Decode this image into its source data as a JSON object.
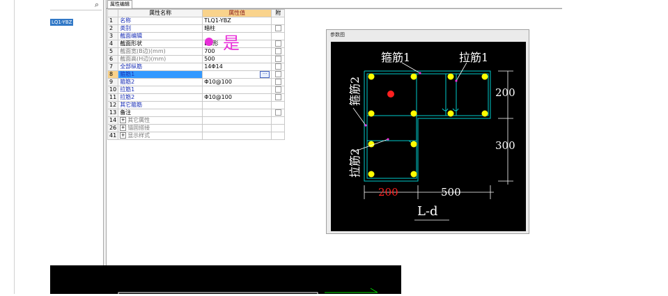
{
  "left": {
    "search_icon": "⌕",
    "tree_item": "LQ1-YBZ"
  },
  "tab": {
    "label": "属性编辑"
  },
  "grid": {
    "headers": {
      "name": "属性名称",
      "value": "属性值",
      "extra": "附"
    },
    "rows": [
      {
        "no": "1",
        "name": "名称",
        "value": "TLQ1-YBZ",
        "style": "blue",
        "cb": false
      },
      {
        "no": "2",
        "name": "类别",
        "value": "暗柱",
        "style": "blue",
        "cb": true
      },
      {
        "no": "3",
        "name": "截面编辑",
        "value": "",
        "style": "blue",
        "cb": false
      },
      {
        "no": "4",
        "name": "截面形状",
        "value": "L-d形",
        "style": "black",
        "cb": true
      },
      {
        "no": "5",
        "name": "截面宽(B边)(mm)",
        "value": "700",
        "style": "grey",
        "cb": true
      },
      {
        "no": "6",
        "name": "截面高(H边)(mm)",
        "value": "500",
        "style": "grey",
        "cb": true
      },
      {
        "no": "7",
        "name": "全部纵筋",
        "value": "14Φ14",
        "style": "blue",
        "cb": true
      },
      {
        "no": "8",
        "name": "箍筋1",
        "value": "",
        "style": "blue",
        "cb": true,
        "selected": true
      },
      {
        "no": "9",
        "name": "箍筋2",
        "value": "Φ10@100",
        "style": "blue",
        "cb": true
      },
      {
        "no": "10",
        "name": "拉筋1",
        "value": "",
        "style": "blue",
        "cb": true
      },
      {
        "no": "11",
        "name": "拉筋2",
        "value": "Φ10@100",
        "style": "blue",
        "cb": true
      },
      {
        "no": "12",
        "name": "其它箍筋",
        "value": "",
        "style": "blue",
        "cb": false
      },
      {
        "no": "13",
        "name": "备注",
        "value": "",
        "style": "black",
        "cb": true
      },
      {
        "no": "14",
        "name": "其它属性",
        "value": "",
        "style": "grey",
        "cb": false,
        "expander": "+"
      },
      {
        "no": "26",
        "name": "锚固搭接",
        "value": "",
        "style": "grey",
        "cb": false,
        "expander": "+"
      },
      {
        "no": "41",
        "name": "显示样式",
        "value": "",
        "style": "grey",
        "cb": false,
        "expander": "+"
      }
    ],
    "dots_label": "···"
  },
  "annotation": {
    "text": "是",
    "color": "#e82fd8"
  },
  "reference": {
    "title": "参数图",
    "labels": {
      "stirrup1": "箍筋1",
      "tie1": "拉筋1",
      "stirrup2": "箍筋2",
      "tie2": "拉筋2",
      "dim_200_right": "200",
      "dim_300_right": "300",
      "dim_200_bottom": "200",
      "dim_500_bottom": "500",
      "section_name": "L-d"
    },
    "colors": {
      "bar": "#ffff00",
      "stirrup": "#00cccc",
      "label": "#ffffff",
      "highlight": "#ff2020",
      "tick": "#e82fd8"
    }
  }
}
